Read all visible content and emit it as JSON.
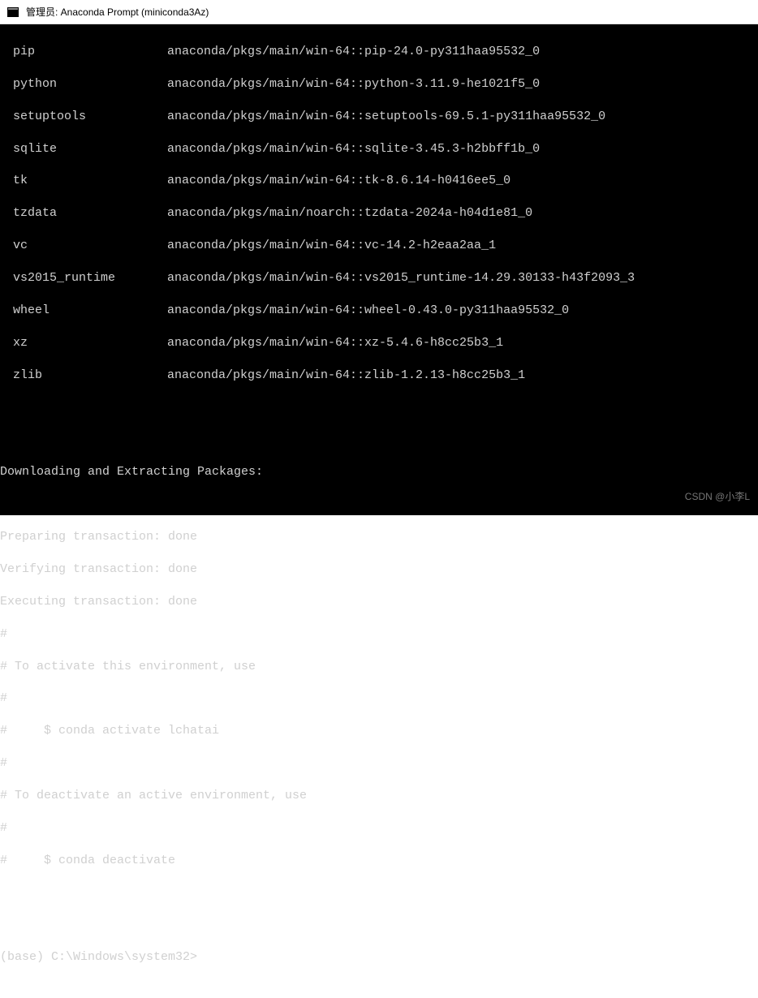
{
  "window": {
    "title": "管理员: Anaconda Prompt (miniconda3Az)"
  },
  "packages": [
    {
      "name": "pip",
      "spec": "anaconda/pkgs/main/win-64::pip-24.0-py311haa95532_0"
    },
    {
      "name": "python",
      "spec": "anaconda/pkgs/main/win-64::python-3.11.9-he1021f5_0"
    },
    {
      "name": "setuptools",
      "spec": "anaconda/pkgs/main/win-64::setuptools-69.5.1-py311haa95532_0"
    },
    {
      "name": "sqlite",
      "spec": "anaconda/pkgs/main/win-64::sqlite-3.45.3-h2bbff1b_0"
    },
    {
      "name": "tk",
      "spec": "anaconda/pkgs/main/win-64::tk-8.6.14-h0416ee5_0"
    },
    {
      "name": "tzdata",
      "spec": "anaconda/pkgs/main/noarch::tzdata-2024a-h04d1e81_0"
    },
    {
      "name": "vc",
      "spec": "anaconda/pkgs/main/win-64::vc-14.2-h2eaa2aa_1"
    },
    {
      "name": "vs2015_runtime",
      "spec": "anaconda/pkgs/main/win-64::vs2015_runtime-14.29.30133-h43f2093_3"
    },
    {
      "name": "wheel",
      "spec": "anaconda/pkgs/main/win-64::wheel-0.43.0-py311haa95532_0"
    },
    {
      "name": "xz",
      "spec": "anaconda/pkgs/main/win-64::xz-5.4.6-h8cc25b3_1"
    },
    {
      "name": "zlib",
      "spec": "anaconda/pkgs/main/win-64::zlib-1.2.13-h8cc25b3_1"
    }
  ],
  "messages": {
    "blank1": "",
    "blank2": "",
    "download": "Downloading and Extracting Packages:",
    "blank3": "",
    "preparing": "Preparing transaction: done",
    "verifying": "Verifying transaction: done",
    "executing": "Executing transaction: done",
    "hash1": "#",
    "activate_msg": "# To activate this environment, use",
    "hash2": "#",
    "activate_cmd": "#     $ conda activate lchatai",
    "hash3": "#",
    "deactivate_msg": "# To deactivate an active environment, use",
    "hash4": "#",
    "deactivate_cmd": "#     $ conda deactivate",
    "blank4": "",
    "blank5": ""
  },
  "prompt": {
    "text": "(base) C:\\Windows\\system32>"
  },
  "watermark": "CSDN @小李L"
}
